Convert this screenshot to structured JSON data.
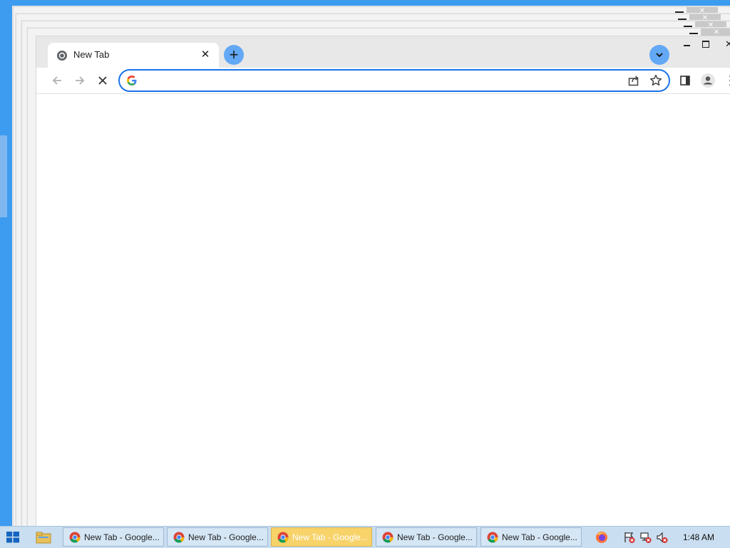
{
  "browser": {
    "tab": {
      "title": "New Tab"
    },
    "omnibox": {
      "value": "",
      "placeholder": ""
    }
  },
  "taskbar": {
    "tasks": [
      {
        "label": "New Tab - Google..."
      },
      {
        "label": "New Tab - Google..."
      },
      {
        "label": "New Tab - Google..."
      },
      {
        "label": "New Tab - Google..."
      },
      {
        "label": "New Tab - Google..."
      }
    ],
    "active_index": 2,
    "clock": "1:48 AM"
  },
  "colors": {
    "desktop": "#3d9bf0",
    "accent": "#1a73e8",
    "taskbar": "#c9def0",
    "active_task": "#f7d36a"
  }
}
